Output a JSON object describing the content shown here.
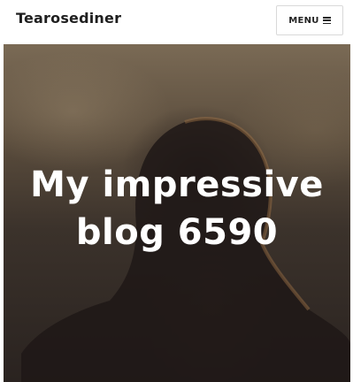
{
  "header": {
    "site_title": "Tearosediner",
    "menu_label": "MENU"
  },
  "hero": {
    "title_line1": "My impressive",
    "title_line2": "blog 6590"
  },
  "icons": {
    "menu": "hamburger-icon"
  }
}
